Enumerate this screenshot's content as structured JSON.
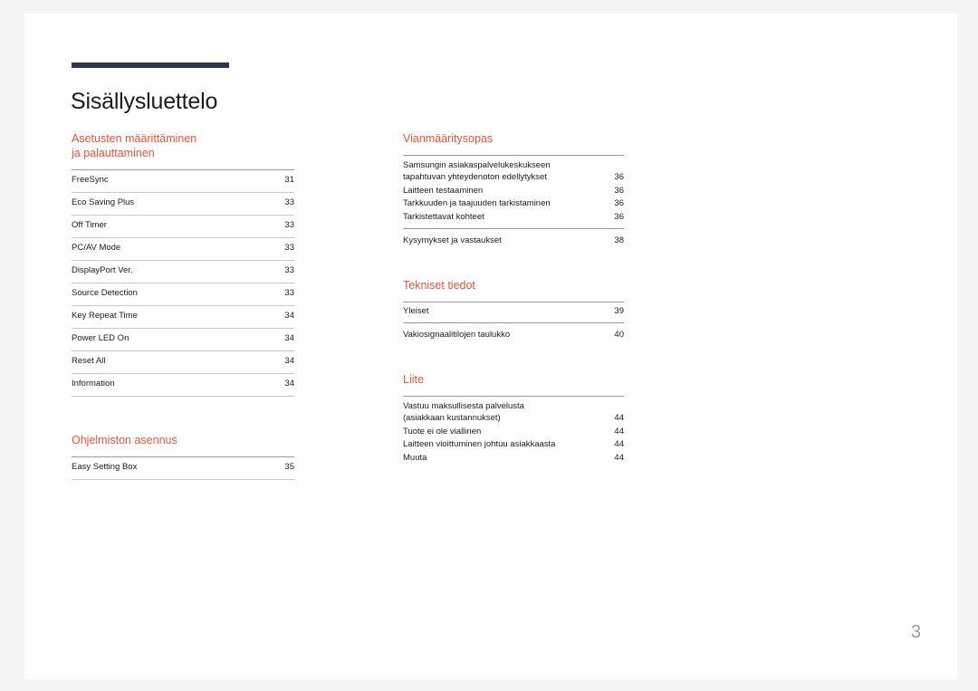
{
  "document": {
    "title": "Sisällysluettelo",
    "folio": "3",
    "accent_color": "#e8543a",
    "rule_color": "#2e3650"
  },
  "left_column": {
    "sections": [
      {
        "heading": "Asetusten määrittäminen\nja palauttaminen",
        "style": "boxed",
        "entries": [
          {
            "label": "FreeSync",
            "page": "31"
          },
          {
            "label": "Eco Saving Plus",
            "page": "33"
          },
          {
            "label": "Off Timer",
            "page": "33"
          },
          {
            "label": "PC/AV Mode",
            "page": "33"
          },
          {
            "label": "DisplayPort Ver.",
            "page": "33"
          },
          {
            "label": "Source Detection",
            "page": "33"
          },
          {
            "label": "Key Repeat Time",
            "page": "34"
          },
          {
            "label": "Power LED On",
            "page": "34"
          },
          {
            "label": "Reset All",
            "page": "34"
          },
          {
            "label": "Information",
            "page": "34"
          }
        ]
      },
      {
        "heading": "Ohjelmiston asennus",
        "style": "boxed",
        "entries": [
          {
            "label": "Easy Setting Box",
            "page": "35"
          }
        ]
      }
    ]
  },
  "right_column": {
    "sections": [
      {
        "heading": "Vianmääritysopas",
        "style": "compact",
        "entries": [
          {
            "label": "Samsungin asiakaspalvelukeskukseen\ntapahtuvan yhteydenoton edellytykset",
            "page": "36",
            "separator": false
          },
          {
            "label": "Laitteen testaaminen",
            "page": "36",
            "separator": false
          },
          {
            "label": "Tarkkuuden ja taajuuden tarkistaminen",
            "page": "36",
            "separator": false
          },
          {
            "label": "Tarkistettavat kohteet",
            "page": "36",
            "separator": false
          },
          {
            "label": "Kysymykset ja vastaukset",
            "page": "38",
            "separator": true
          }
        ]
      },
      {
        "heading": "Tekniset tiedot",
        "style": "compact",
        "entries": [
          {
            "label": "Yleiset",
            "page": "39",
            "separator": false
          },
          {
            "label": "Vakiosignaalitilojen taulukko",
            "page": "40",
            "separator": true
          }
        ]
      },
      {
        "heading": "Liite",
        "style": "compact",
        "entries": [
          {
            "label": "Vastuu maksullisesta palvelusta\n(asiakkaan kustannukset)",
            "page": "44",
            "separator": false
          },
          {
            "label": "Tuote ei ole viallinen",
            "page": "44",
            "separator": false
          },
          {
            "label": "Laitteen vioittuminen johtuu asiakkaasta",
            "page": "44",
            "separator": false
          },
          {
            "label": "Muuta",
            "page": "44",
            "separator": false
          }
        ]
      }
    ]
  }
}
